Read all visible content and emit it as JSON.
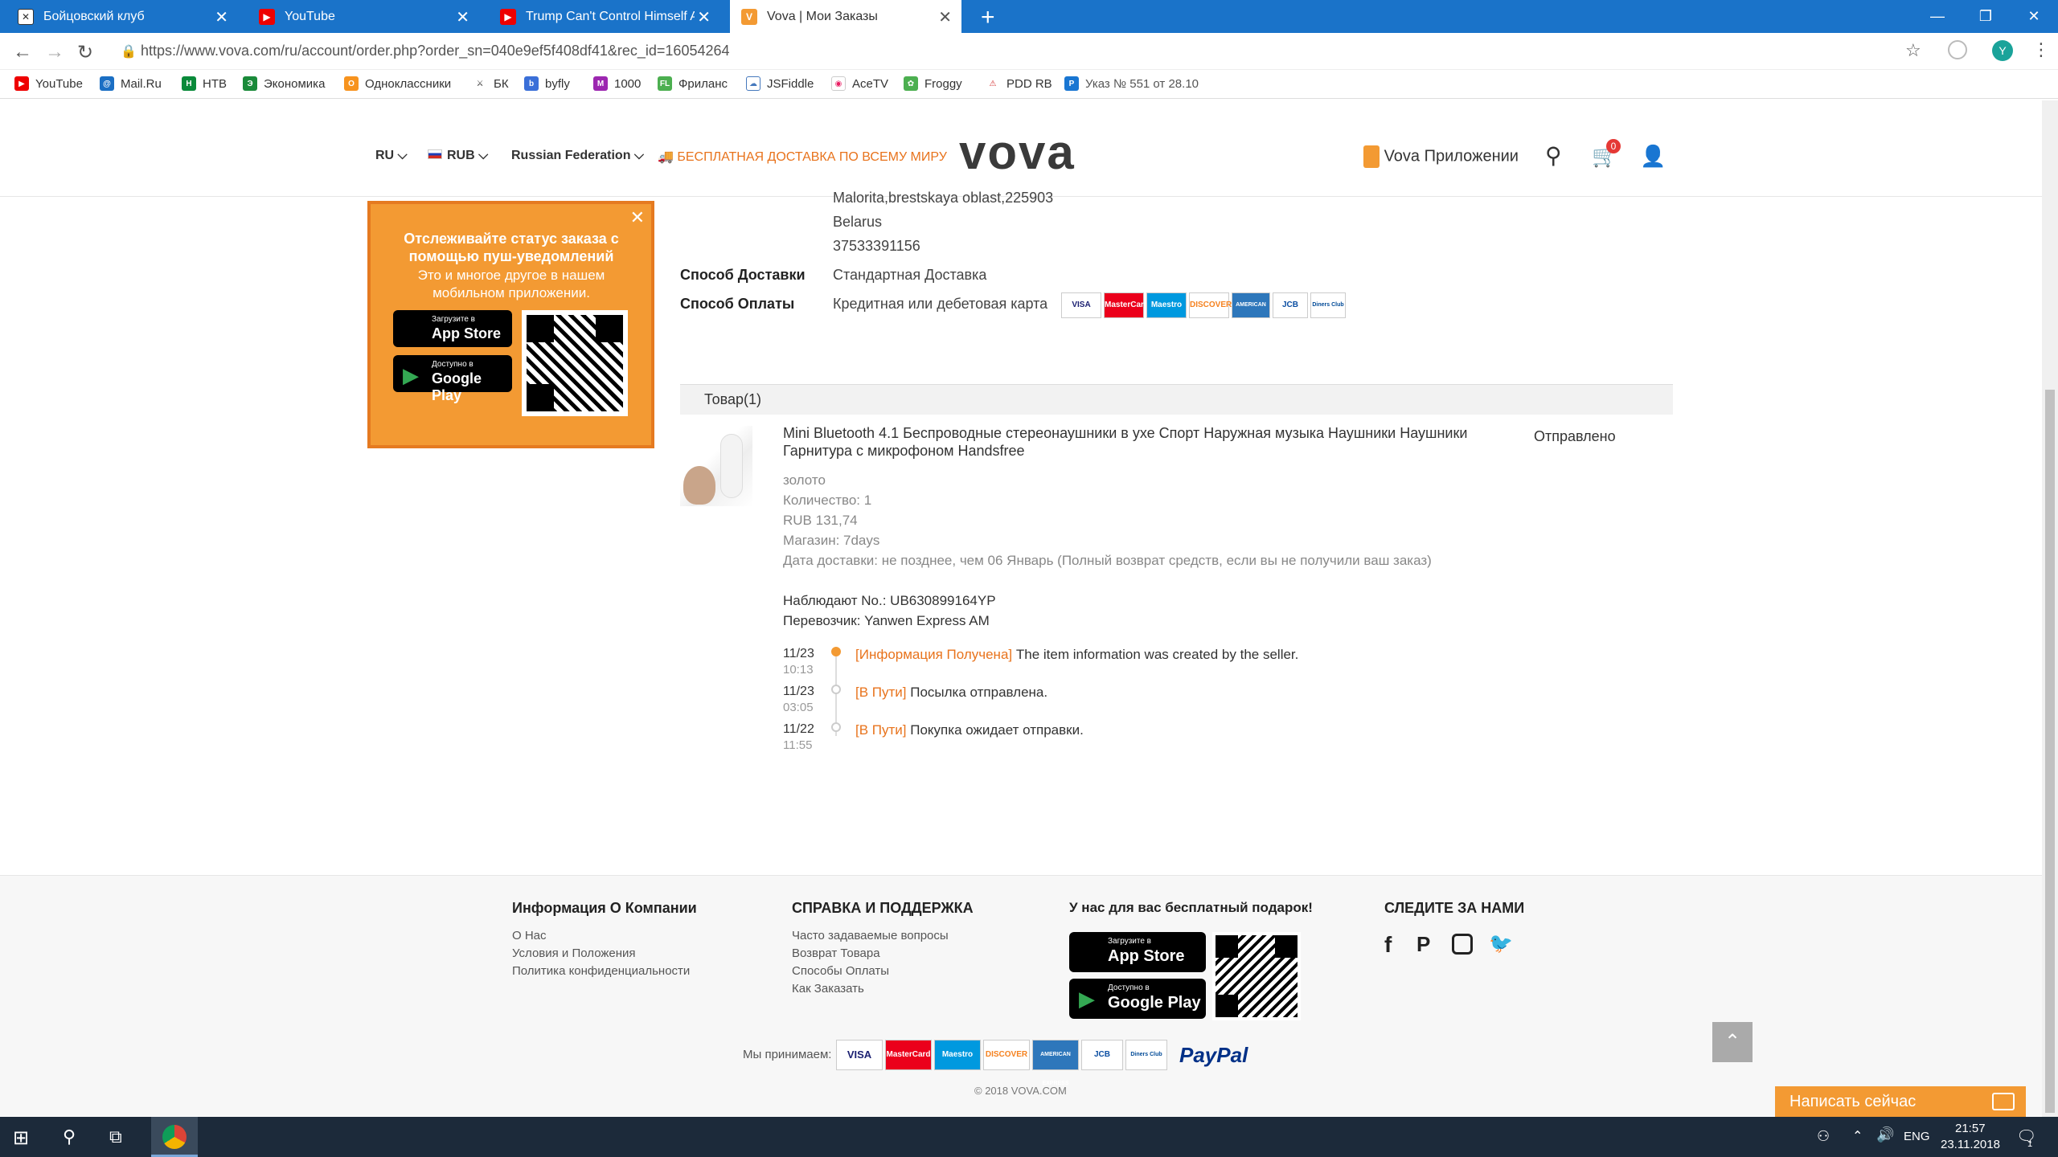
{
  "browser": {
    "tabs": [
      {
        "label": "Бойцовский клуб",
        "icon": "fightclub-icon"
      },
      {
        "label": "YouTube",
        "icon": "youtube-icon"
      },
      {
        "label": "Trump Can't Control Himself Aro",
        "icon": "youtube-icon"
      },
      {
        "label": "Vova | Мои Заказы",
        "icon": "vova-icon"
      }
    ],
    "url": "https://www.vova.com/ru/account/order.php?order_sn=040e9ef5f408df41&rec_id=16054264",
    "profile_initial": "Y",
    "bookmarks": [
      "YouTube",
      "Mail.Ru",
      "НТВ",
      "Экономика",
      "Одноклассники",
      "БК",
      "byfly",
      "1000",
      "Фриланс",
      "JSFiddle",
      "AceTV",
      "Froggy",
      "PDD RB",
      "Указ № 551 от 28.10"
    ]
  },
  "header": {
    "language": "RU",
    "currency": "RUB",
    "country": "Russian Federation",
    "free_shipping": "БЕСПЛАТНАЯ ДОСТАВКА ПО ВСЕМУ МИРУ",
    "logo": "vova",
    "app_link": "Vova Приложении",
    "cart_count": "0"
  },
  "promo": {
    "title": "Отслеживайте статус заказа с помощью пуш-уведомлений",
    "subtitle": "Это и многое другое в нашем мобильном приложении.",
    "appstore_small": "Загрузите в",
    "appstore_big": "App Store",
    "gplay_small": "Доступно в",
    "gplay_big": "Google Play"
  },
  "order": {
    "address_line": "Malorita,brestskaya oblast,225903",
    "country": "Belarus",
    "phone": "37533391156",
    "shipping_label": "Способ Доставки",
    "shipping_value": "Стандартная Доставка",
    "payment_label": "Способ Оплаты",
    "payment_value": "Кредитная или дебетовая карта",
    "goods_header": "Товар(1)",
    "item": {
      "title": "Mini Bluetooth 4.1 Беспроводные стереонаушники в ухе Спорт Наружная музыка Наушники Наушники Гарнитура с микрофоном Handsfree",
      "status": "Отправлено",
      "color": "золото",
      "quantity": "Количество: 1",
      "price": "RUB 131,74",
      "store": "Магазин: 7days",
      "delivery": "Дата доставки: не позднее, чем 06 Январь (Полный возврат средств, если вы не получили ваш заказ)",
      "tracking_no": "Наблюдают No.: UB630899164YP",
      "carrier": "Перевозчик: Yanwen Express AM"
    },
    "tracking": [
      {
        "date": "11/23",
        "time": "10:13",
        "tag": "[Информация Получена]",
        "text": "The item information was created by the seller."
      },
      {
        "date": "11/23",
        "time": "03:05",
        "tag": "[В Пути]",
        "text": "Посылка отправлена."
      },
      {
        "date": "11/22",
        "time": "11:55",
        "tag": "[В Пути]",
        "text": "Покупка ожидает отправки."
      }
    ]
  },
  "footer": {
    "about_title": "Информация О Компании",
    "about_links": [
      "О Нас",
      "Условия и Положения",
      "Политика конфиденциальности"
    ],
    "support_title": "СПРАВКА И ПОДДЕРЖКА",
    "support_links": [
      "Часто задаваемые вопросы",
      "Возврат Товара",
      "Способы Оплаты",
      "Как Заказать"
    ],
    "gift_title": "У нас для вас бесплатный подарок!",
    "follow_title": "СЛЕДИТЕ ЗА НАМИ",
    "accept_label": "Мы принимаем:",
    "copyright": "© 2018 VOVA.COM",
    "chat_button": "Написать сейчас"
  },
  "cards": [
    "VISA",
    "MasterCard",
    "Maestro",
    "DISCOVER",
    "AMERICAN EXPRESS",
    "JCB",
    "Diners Club"
  ],
  "paypal": "PayPal",
  "taskbar": {
    "lang": "ENG",
    "time": "21:57",
    "date": "23.11.2018",
    "notifications": "1"
  },
  "colors": {
    "accent": "#e8731c",
    "chrome": "#1a73c9",
    "taskbar": "#1c2a3a"
  }
}
